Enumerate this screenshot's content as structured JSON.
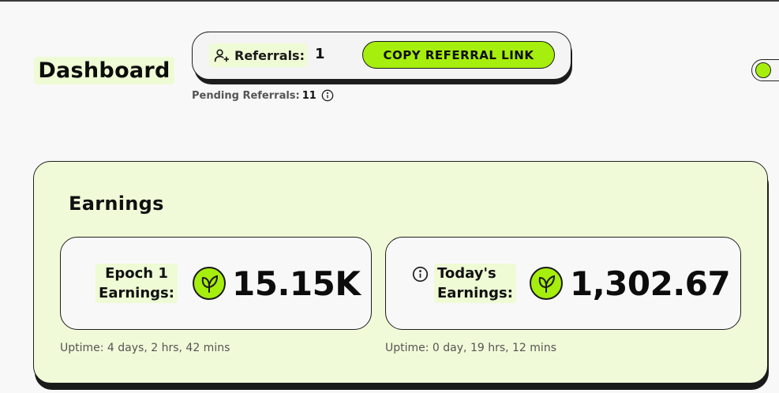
{
  "header": {
    "title": "Dashboard"
  },
  "referrals": {
    "label": "Referrals:",
    "count": "1",
    "copy_button": "COPY REFERRAL LINK",
    "pending_label": "Pending Referrals:",
    "pending_count": "11"
  },
  "earnings": {
    "title": "Earnings",
    "epoch": {
      "label_line1": "Epoch 1",
      "label_line2": "Earnings:",
      "value": "15.15K",
      "uptime": "Uptime: 4 days, 2 hrs, 42 mins"
    },
    "today": {
      "label_line1": "Today's",
      "label_line2": "Earnings:",
      "value": "1,302.67",
      "uptime": "Uptime: 0 day, 19 hrs, 12 mins"
    }
  },
  "colors": {
    "accent": "#a6ee0d",
    "highlight": "#eefbd5",
    "card_bg": "#f1fad8"
  },
  "icons": {
    "referral": "user-plus-icon",
    "info": "info-icon",
    "token": "leaf-icon"
  }
}
